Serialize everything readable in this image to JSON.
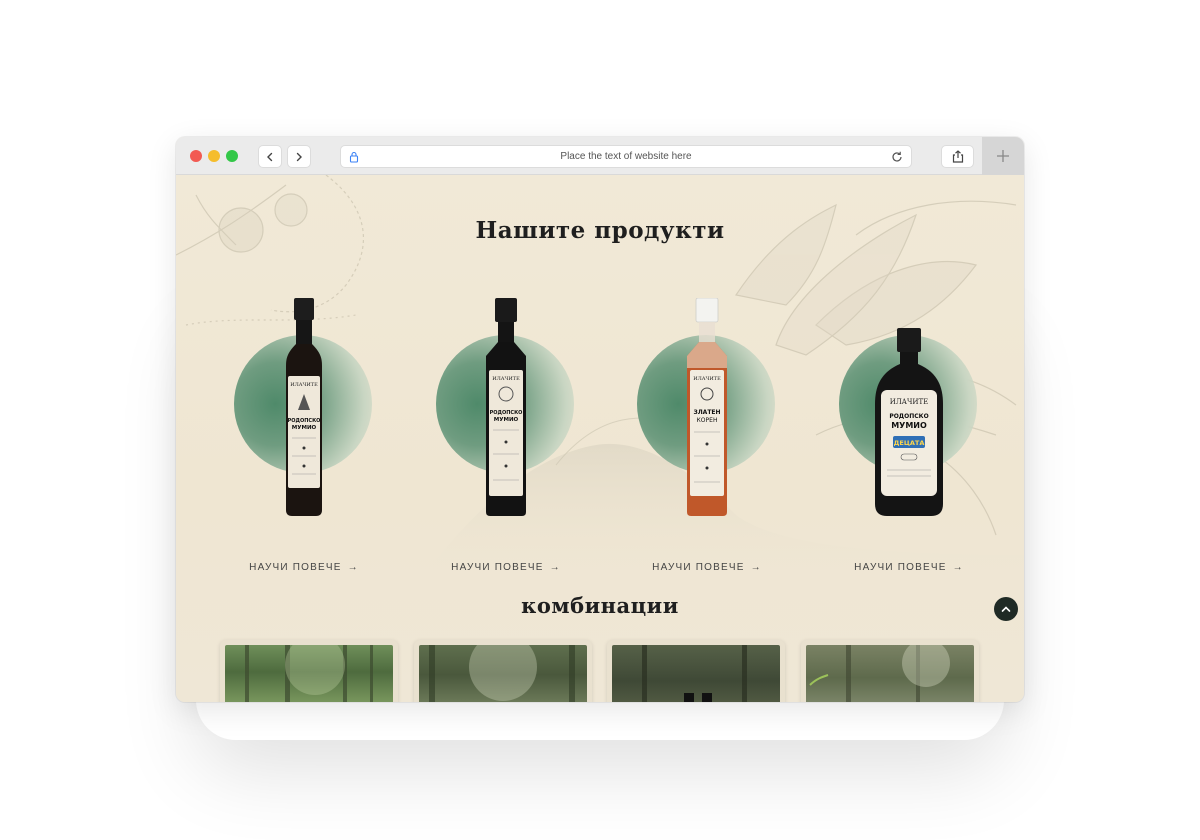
{
  "browser": {
    "url_placeholder": "Place the text of website here",
    "icons": [
      "back-chevron-icon",
      "forward-chevron-icon",
      "lock-icon",
      "reload-icon",
      "share-icon",
      "plus-icon"
    ]
  },
  "page": {
    "products_title": "Нашите продукти",
    "combos_title": "комбинации",
    "learn_more_label": "НАУЧИ ПОВЕЧЕ",
    "products": [
      {
        "brand": "ИЛАЧИТЕ",
        "name": "РОДОПСКО МУМИО",
        "liquid": "dark",
        "bottle": "tall"
      },
      {
        "brand": "ИЛАЧИТЕ",
        "name": "РОДОПСКО МУМИО",
        "liquid": "dark",
        "bottle": "square"
      },
      {
        "brand": "ИЛАЧИТЕ",
        "name": "ЗЛАТЕН КОРЕН",
        "liquid": "amber",
        "bottle": "square"
      },
      {
        "brand": "ИЛАЧИТЕ",
        "name": "РОДОПСКО МУМИО",
        "sub": "ДЕЦАТА",
        "liquid": "dark",
        "bottle": "round"
      }
    ],
    "combos_count": 4
  },
  "colors": {
    "background": "#efe7d6",
    "accent_green": "#4f8a6a",
    "text_dark": "#1f1f1f",
    "amber": "#c0582a"
  }
}
